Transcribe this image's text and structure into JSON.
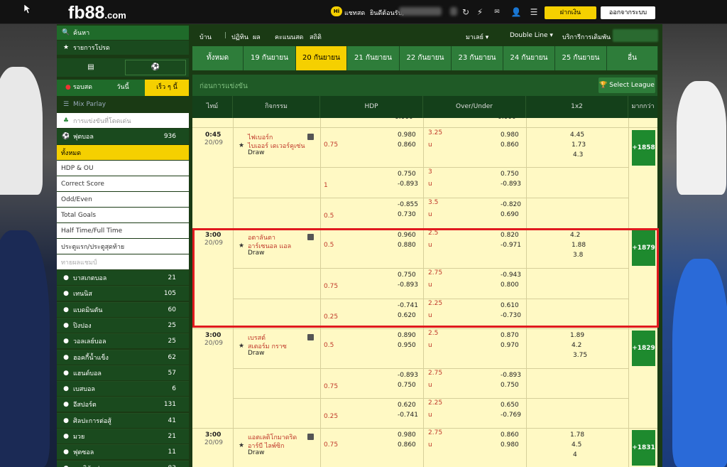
{
  "header": {
    "logo": "fb88",
    "logo_suffix": ".com",
    "hi_badge": "Hi",
    "chat_label": "แชทสด",
    "welcome": "ยินดีต้อนรับ,",
    "deposit_label": "ฝากเงิน",
    "logout_label": "ออกจากระบบ"
  },
  "sidebar": {
    "search_label": "ค้นหา",
    "favorites_label": "รายการโปรด",
    "filter_tabs": [
      {
        "label": "รอบสด"
      },
      {
        "label": "วันนี้"
      },
      {
        "label": "เร็ว ๆ นี้"
      }
    ],
    "mix_parlay": "Mix Parlay",
    "selected_competitions": "การแข่งขันที่โดดเด่น",
    "football": {
      "label": "ฟุตบอล",
      "count": "936"
    },
    "football_subs": [
      "ทั้งหมด",
      "HDP & OU",
      "Correct Score",
      "Odd/Even",
      "Total Goals",
      "Half Time/Full Time",
      "ประตูแรก/ประตูสุดท้าย",
      "ทายผลแชมป์"
    ],
    "sports": [
      {
        "label": "บาสเกตบอล",
        "count": "21",
        "icon": "basketball-icon"
      },
      {
        "label": "เทนนิส",
        "count": "105",
        "icon": "tennis-icon"
      },
      {
        "label": "แบดมินตัน",
        "count": "60",
        "icon": "badminton-icon"
      },
      {
        "label": "ปิงปอง",
        "count": "25",
        "icon": "table-tennis-icon"
      },
      {
        "label": "วอลเลย์บอล",
        "count": "25",
        "icon": "volleyball-icon"
      },
      {
        "label": "ฮอคกี้น้ำแข็ง",
        "count": "62",
        "icon": "ice-hockey-icon"
      },
      {
        "label": "แฮนด์บอล",
        "count": "57",
        "icon": "handball-icon"
      },
      {
        "label": "เบสบอล",
        "count": "6",
        "icon": "baseball-icon"
      },
      {
        "label": "อีสปอร์ต",
        "count": "131",
        "icon": "esports-icon"
      },
      {
        "label": "ศิลปะการต่อสู้",
        "count": "41",
        "icon": "martial-arts-icon"
      },
      {
        "label": "มวย",
        "count": "21",
        "icon": "boxing-icon"
      },
      {
        "label": "ฟุตซอล",
        "count": "11",
        "icon": "futsal-icon"
      },
      {
        "label": "อเมริกันฟุตบอล",
        "count": "83",
        "icon": "american-football-icon"
      }
    ]
  },
  "nav": {
    "home": "บ้าน",
    "calendar": "ปฏิทิน",
    "results": "ผล",
    "scores": "คะแนนสด",
    "stats": "สถิติ",
    "odds_type": "มาเลย์",
    "line_type": "Double Line",
    "extra_services": "บริการีการเดิมพัน"
  },
  "date_tabs": [
    "ทั้งหมด",
    "19 กันยายน",
    "20 กันยายน",
    "21 กันยายน",
    "22 กันยายน",
    "23 กันยายน",
    "24 กันยายน",
    "25 กันยายน",
    "อื่น"
  ],
  "active_date_index": 2,
  "section_title": "ก่อนการแข่งขัน",
  "select_league": "Select League",
  "columns": {
    "time": "ไทม์",
    "event": "กิจกรรม",
    "hdp": "HDP",
    "ou": "Over/Under",
    "x12": "1x2",
    "more": "มากกว่า"
  },
  "top_partial": {
    "hdp": "0.000",
    "ou": "0.000"
  },
  "matches": [
    {
      "time": "0:45",
      "date": "20/09",
      "home": "ไฟเบอร์ก",
      "away": "ไบเออร์ เดเวอร์คูเซ่น",
      "draw": "Draw",
      "x12": [
        "4.45",
        "1.73",
        "4.3"
      ],
      "more": "+1858",
      "lines": [
        {
          "hdp_line": "0.75",
          "hdp_home": "0.980",
          "hdp_away": "0.860",
          "ou_line": "3.25",
          "ou_u": "u",
          "ou_over": "0.980",
          "ou_under": "0.860"
        },
        {
          "hdp_line": "1",
          "hdp_home": "0.750",
          "hdp_away": "-0.893",
          "ou_line": "3",
          "ou_u": "u",
          "ou_over": "0.750",
          "ou_under": "-0.893"
        },
        {
          "hdp_line": "0.5",
          "hdp_home": "-0.855",
          "hdp_away": "0.730",
          "ou_line": "3.5",
          "ou_u": "u",
          "ou_over": "-0.820",
          "ou_under": "0.690"
        }
      ]
    },
    {
      "time": "3:00",
      "date": "20/09",
      "home": "อตาลันตา",
      "away": "อาร์เซนอล แอล",
      "draw": "Draw",
      "x12": [
        "4.2",
        "1.88",
        "3.8"
      ],
      "more": "+1879",
      "lines": [
        {
          "hdp_line": "0.5",
          "hdp_home": "0.960",
          "hdp_away": "0.880",
          "ou_line": "2.5",
          "ou_u": "u",
          "ou_over": "0.820",
          "ou_under": "-0.971"
        },
        {
          "hdp_line": "0.75",
          "hdp_home": "0.750",
          "hdp_away": "-0.893",
          "ou_line": "2.75",
          "ou_u": "u",
          "ou_over": "-0.943",
          "ou_under": "0.800"
        },
        {
          "hdp_line": "0.25",
          "hdp_home": "-0.741",
          "hdp_away": "0.620",
          "ou_line": "2.25",
          "ou_u": "u",
          "ou_over": "0.610",
          "ou_under": "-0.730"
        }
      ]
    },
    {
      "time": "3:00",
      "date": "20/09",
      "home": "เบรสต์",
      "away": "สเตอร์ม กราซ",
      "draw": "Draw",
      "x12": [
        "1.89",
        "4.2",
        "3.75"
      ],
      "more": "+1829",
      "lines": [
        {
          "hdp_line": "0.5",
          "hdp_home": "0.890",
          "hdp_away": "0.950",
          "ou_line": "2.5",
          "ou_u": "u",
          "ou_over": "0.870",
          "ou_under": "0.970"
        },
        {
          "hdp_line": "0.75",
          "hdp_home": "-0.893",
          "hdp_away": "0.750",
          "ou_line": "2.75",
          "ou_u": "u",
          "ou_over": "-0.893",
          "ou_under": "0.750"
        },
        {
          "hdp_line": "0.25",
          "hdp_home": "0.620",
          "hdp_away": "-0.741",
          "ou_line": "2.25",
          "ou_u": "u",
          "ou_over": "0.650",
          "ou_under": "-0.769"
        }
      ]
    },
    {
      "time": "3:00",
      "date": "20/09",
      "home": "แอตเลติโกมาดริด",
      "away": "อาร์บี ไลพ์ซิก",
      "draw": "Draw",
      "x12": [
        "1.78",
        "4.5",
        "4"
      ],
      "more": "+1831",
      "lines": [
        {
          "hdp_line": "0.75",
          "hdp_home": "0.980",
          "hdp_away": "0.860",
          "ou_line": "2.75",
          "ou_u": "u",
          "ou_over": "0.860",
          "ou_under": "0.980"
        }
      ]
    }
  ]
}
